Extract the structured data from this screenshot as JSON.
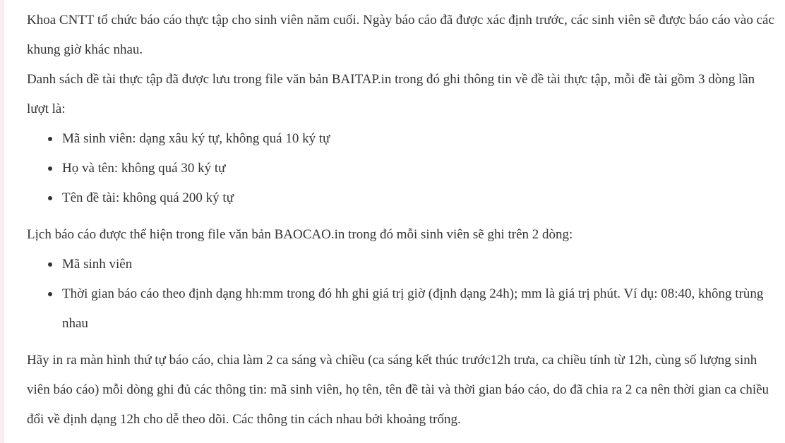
{
  "paragraphs": {
    "intro": "Khoa CNTT tổ chức báo cáo thực tập cho sinh viên năm cuối. Ngày báo cáo đã được xác định trước, các sinh viên sẽ được báo cáo vào các khung giờ khác nhau.",
    "topics_file": "Danh sách đề tài thực tập đã được lưu trong file văn bản BAITAP.in trong đó ghi thông tin về đề tài thực tập, mỗi đề tài gồm 3 dòng lần lượt là:",
    "schedule_file": "Lịch báo cáo được thể hiện trong file văn bản BAOCAO.in trong đó mỗi sinh viên sẽ ghi trên 2 dòng:",
    "task": "Hãy in ra màn hình thứ tự báo cáo, chia làm 2 ca sáng và chiều (ca sáng kết thúc trước12h trưa, ca chiều tính từ 12h, cùng số lượng sinh viên báo cáo) mỗi dòng ghi đủ các thông tin: mã sinh viên, họ tên, tên đề tài và thời gian báo cáo, do đã chia ra 2 ca nên thời gian ca chiều đổi về định dạng 12h cho dễ theo dõi. Các thông tin cách nhau bởi khoảng trống."
  },
  "topics_list": [
    "Mã sinh viên: dạng xâu ký tự, không quá 10 ký tự",
    "Họ và tên: không quá 30 ký tự",
    "Tên đề tài: không quá 200 ký tự"
  ],
  "schedule_list": [
    "Mã sinh viên",
    "Thời gian báo cáo theo định dạng hh:mm trong đó hh ghi giá trị giờ (định dạng 24h); mm là giá trị phút. Ví dụ: 08:40, không trùng nhau"
  ]
}
